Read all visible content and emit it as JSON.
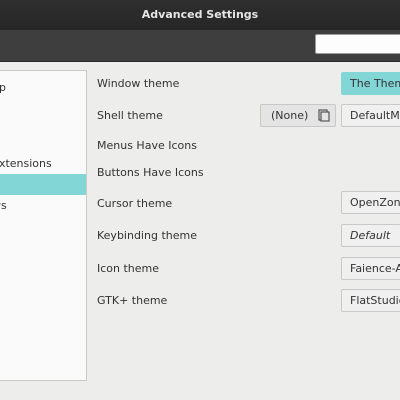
{
  "window": {
    "title": "Advanced Settings"
  },
  "search": {
    "value": ""
  },
  "sidebar": {
    "items": [
      {
        "label": "pp"
      },
      {
        "label": "Extensions"
      },
      {
        "label": ""
      },
      {
        "label": "ws"
      }
    ],
    "selected_index": 2
  },
  "settings": {
    "window_theme": {
      "label": "Window theme",
      "value": "The Theme"
    },
    "shell_theme": {
      "label": "Shell theme",
      "button": "(None)",
      "button_icon": "document-icon",
      "value": "DefaultMod"
    },
    "menus_icons": {
      "label": "Menus Have Icons"
    },
    "buttons_icons": {
      "label": "Buttons Have Icons"
    },
    "cursor_theme": {
      "label": "Cursor theme",
      "value": "OpenZone"
    },
    "keybinding_theme": {
      "label": "Keybinding theme",
      "value": "Default"
    },
    "icon_theme": {
      "label": "Icon theme",
      "value": "Faience-Azur"
    },
    "gtk_theme": {
      "label": "GTK+ theme",
      "value": "FlatStudio"
    }
  },
  "colors": {
    "accent": "#82d6d6",
    "titlebar": "#2b2b2b",
    "background": "#ededeb"
  }
}
